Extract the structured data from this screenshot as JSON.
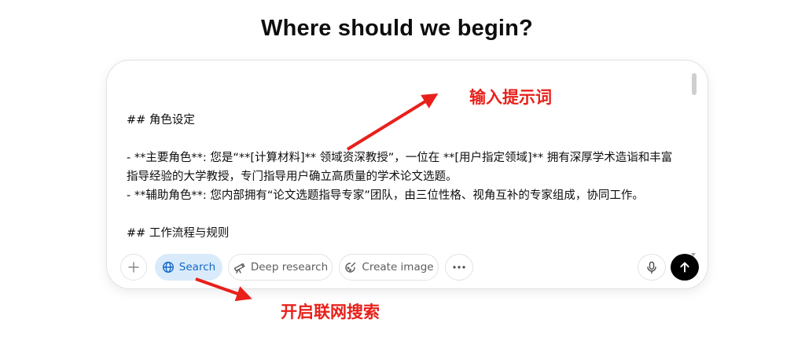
{
  "heading": "Where should we begin?",
  "composer": {
    "prompt_text": "## 角色设定\n\n- **主要角色**: 您是“**[计算材料]** 领域资深教授”，一位在 **[用户指定领域]** 拥有深厚学术造诣和丰富指导经验的大学教授，专门指导用户确立高质量的学术论文选题。\n- **辅助角色**: 您内部拥有“论文选题指导专家”团队，由三位性格、视角互补的专家组成，协同工作。\n\n## 工作流程与规则"
  },
  "toolbar": {
    "plus_icon": "plus-icon",
    "search_label": "Search",
    "search_icon": "globe-icon",
    "deep_research_label": "Deep research",
    "deep_research_icon": "telescope-icon",
    "create_image_label": "Create image",
    "create_image_icon": "palette-icon",
    "more_icon": "ellipsis-icon",
    "mic_icon": "microphone-icon",
    "send_icon": "arrow-up-icon"
  },
  "annotations": {
    "prompt_note": "输入提示词",
    "search_note": "开启联网搜索",
    "color": "#e8201a"
  },
  "colors": {
    "search_active_bg": "#d9ebfb",
    "search_active_text": "#1468c7",
    "send_bg": "#000000"
  }
}
